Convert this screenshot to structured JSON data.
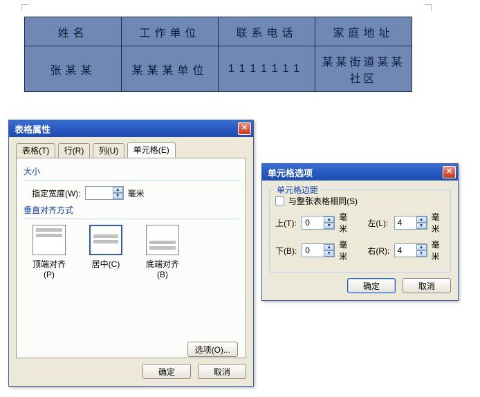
{
  "table": {
    "headers": [
      "姓名",
      "工作单位",
      "联系电话",
      "家庭地址"
    ],
    "row": [
      "张某某",
      "某某某单位",
      "1111111",
      "某某街道某某社区"
    ]
  },
  "dlg_props": {
    "title": "表格属性",
    "tabs": {
      "table": "表格(T)",
      "row": "行(R)",
      "col": "列(U)",
      "cell": "单元格(E)"
    },
    "size_title": "大小",
    "width_label": "指定宽度(W):",
    "width_value": "",
    "width_unit": "毫米",
    "valign_title": "垂直对齐方式",
    "valign": {
      "top": "顶端对齐(P)",
      "mid": "居中(C)",
      "bot": "底端对齐(B)"
    },
    "options_btn": "选项(O)...",
    "ok": "确定",
    "cancel": "取消"
  },
  "dlg_opts": {
    "title": "单元格选项",
    "margin_title": "单元格边距",
    "same_as_table": "与整张表格相同(S)",
    "top_label": "上(T):",
    "bottom_label": "下(B):",
    "left_label": "左(L):",
    "right_label": "右(R):",
    "top_value": "0",
    "bottom_value": "0",
    "left_value": "4",
    "right_value": "4",
    "unit": "毫米",
    "ok": "确定",
    "cancel": "取消"
  }
}
